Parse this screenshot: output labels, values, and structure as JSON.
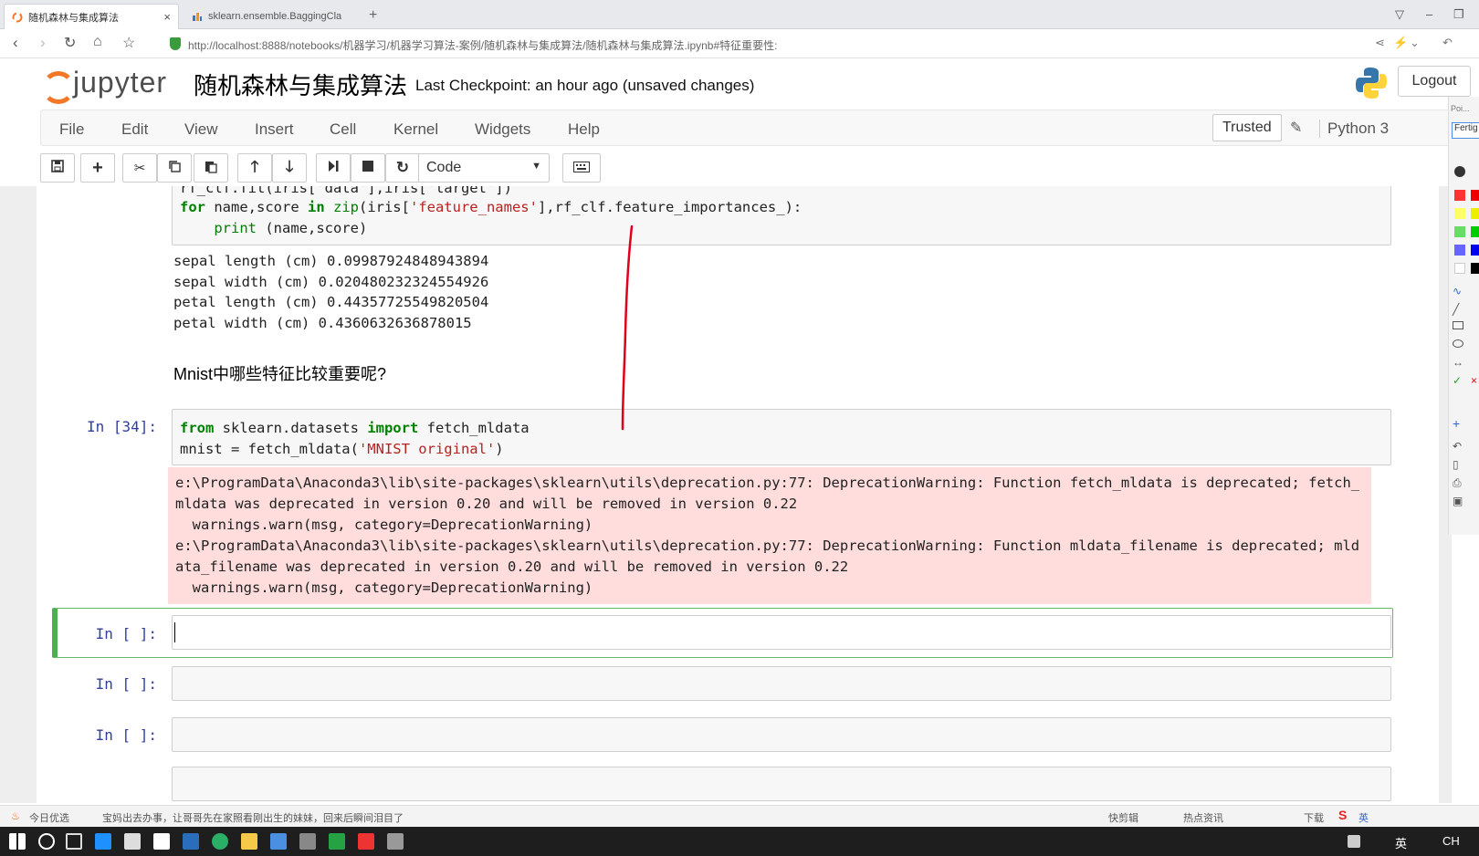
{
  "browser": {
    "tabs": [
      {
        "title": "随机森林与集成算法",
        "active": true
      },
      {
        "title": "sklearn.ensemble.BaggingCla",
        "active": false
      }
    ],
    "url": "http://localhost:8888/notebooks/机器学习/机器学习算法-案例/随机森林与集成算法/随机森林与集成算法.ipynb#特征重要性:"
  },
  "header": {
    "logo_text": "jupyter",
    "title": "随机森林与集成算法",
    "checkpoint": "Last Checkpoint: an hour ago (unsaved changes)",
    "logout": "Logout"
  },
  "menu": {
    "items": [
      "File",
      "Edit",
      "View",
      "Insert",
      "Cell",
      "Kernel",
      "Widgets",
      "Help"
    ],
    "trusted": "Trusted",
    "kernel": "Python 3"
  },
  "toolbar": {
    "cell_type": "Code"
  },
  "cells": {
    "cell1_lines": [
      [
        "rf_clf.fit(iris['data'],iris['target'])"
      ],
      [
        "for",
        " name,score ",
        "in",
        " zip",
        "(iris[",
        "'feature_names'",
        "],rf_clf.feature_importances_):"
      ],
      [
        "    print",
        " (name,score)"
      ]
    ],
    "cell1_output": [
      "sepal length (cm) 0.09987924848943894",
      "sepal width (cm) 0.020480232324554926",
      "petal length (cm) 0.44357725549820504",
      "petal width (cm) 0.4360632636878015"
    ],
    "markdown": "Mnist中哪些特征比较重要呢?",
    "cell2_prompt": "In [34]:",
    "cell2_line1": [
      "from",
      " sklearn.datasets ",
      "import",
      " fetch_mldata"
    ],
    "cell2_line2": [
      "mnist = fetch_mldata(",
      "'MNIST original'",
      ")"
    ],
    "cell2_stderr": [
      "e:\\ProgramData\\Anaconda3\\lib\\site-packages\\sklearn\\utils\\deprecation.py:77: DeprecationWarning: Function fetch_mldata is deprecated; fetch_mldata was deprecated in version 0.20 and will be removed in version 0.22",
      "  warnings.warn(msg, category=DeprecationWarning)",
      "e:\\ProgramData\\Anaconda3\\lib\\site-packages\\sklearn\\utils\\deprecation.py:77: DeprecationWarning: Function mldata_filename is deprecated; mldata_filename was deprecated in version 0.20 and will be removed in version 0.22",
      "  warnings.warn(msg, category=DeprecationWarning)"
    ],
    "empty_prompt": "In [ ]:"
  },
  "palette": {
    "header": "Poi...",
    "tooltip": "Fertig"
  },
  "infobar": {
    "left": "今日优选",
    "news": "宝妈出去办事，让哥哥先在家照看刚出生的妹妹，回来后瞬间泪目了",
    "right1": "快剪辑",
    "right2": "热点资讯",
    "right3": "下载"
  },
  "taskbar": {
    "ime1": "英",
    "ime2": "CH"
  },
  "colors": {
    "accent": "#f37726",
    "prompt": "#303f9f",
    "selected": "#4caf50",
    "stderr_bg": "#ffdddd",
    "annotation": "#e0001b"
  }
}
